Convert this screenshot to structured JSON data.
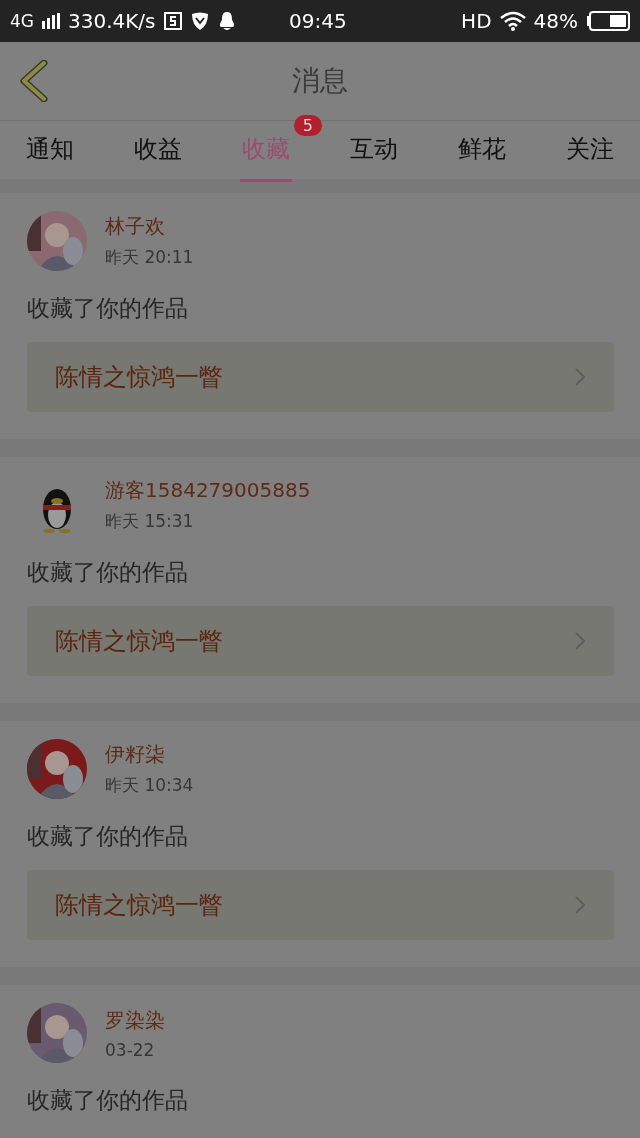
{
  "status_bar": {
    "network": "4G",
    "speed": "330.4K/s",
    "time": "09:45",
    "hd": "HD",
    "battery": "48%"
  },
  "header": {
    "title": "消息"
  },
  "tabs": [
    {
      "label": "通知",
      "selected": false
    },
    {
      "label": "收益",
      "selected": false
    },
    {
      "label": "收藏",
      "selected": true,
      "badge": "5"
    },
    {
      "label": "互动",
      "selected": false
    },
    {
      "label": "鲜花",
      "selected": false
    },
    {
      "label": "关注",
      "selected": false
    }
  ],
  "messages": [
    {
      "name": "林子欢",
      "time": "昨天 20:11",
      "text": "收藏了你的作品",
      "work": "陈情之惊鸿一瞥"
    },
    {
      "avatar": {
        "kind": "default"
      },
      "name": "游客1584279005885",
      "time": "昨天 15:31",
      "text": "收藏了你的作品",
      "work": "陈情之惊鸿一瞥"
    },
    {
      "name": "伊籽柒",
      "time": "昨天 10:34",
      "text": "收藏了你的作品",
      "work": "陈情之惊鸿一瞥"
    },
    {
      "name": "罗染染",
      "time": "03-22",
      "text": "收藏了你的作品"
    }
  ]
}
